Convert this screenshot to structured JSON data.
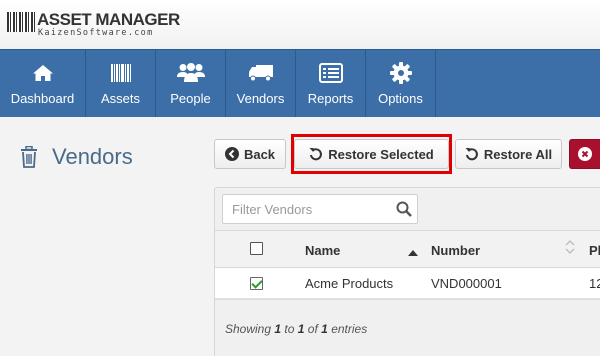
{
  "header": {
    "logo_title": "ASSET MANAGER",
    "logo_subtitle": "KaizenSoftware.com"
  },
  "nav": {
    "items": [
      {
        "label": "Dashboard",
        "icon": "home-icon"
      },
      {
        "label": "Assets",
        "icon": "barcode-icon"
      },
      {
        "label": "People",
        "icon": "users-icon"
      },
      {
        "label": "Vendors",
        "icon": "truck-icon"
      },
      {
        "label": "Reports",
        "icon": "list-icon"
      },
      {
        "label": "Options",
        "icon": "gear-icon"
      }
    ]
  },
  "page": {
    "title": "Vendors",
    "title_icon": "trash-icon"
  },
  "toolbar": {
    "back_label": "Back",
    "restore_selected_label": "Restore Selected",
    "restore_all_label": "Restore All"
  },
  "table": {
    "filter_placeholder": "Filter Vendors",
    "columns": [
      "Name",
      "Number",
      "Ph"
    ],
    "rows": [
      {
        "checked": true,
        "name": "Acme Products",
        "number": "VND000001",
        "phone": "12"
      }
    ],
    "info": {
      "prefix": "Showing",
      "from": "1",
      "to_word": "to",
      "to": "1",
      "of_word": "of",
      "total": "1",
      "suffix": "entries"
    }
  },
  "colors": {
    "nav_bg": "#3c6fa8",
    "highlight": "#e00000",
    "danger": "#a8102e"
  }
}
